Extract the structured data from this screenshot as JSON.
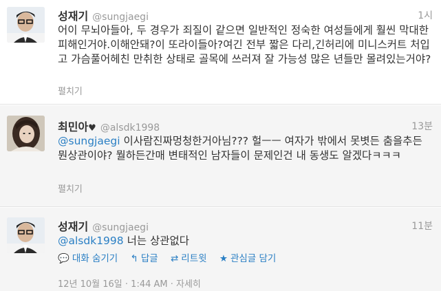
{
  "tweets": [
    {
      "fullname": "성재기",
      "screenname": "@sungjaegi",
      "time": "1시",
      "text": "어이 무뇌아들아, 두 경우가 죄질이 같으면 일반적인 정숙한 여성들에게 훨씬 막대한 피해인거야.이해안돼?이 또라이들아?여긴 전부 짧은 다리,긴허리에 미니스커트 처입고 가슴풀어헤친 만취한 상태로 골목에 쓰러져 잘 가능성 많은 년들만 몰려있는거야?",
      "expand": "펼치기"
    },
    {
      "fullname": "최민아",
      "heart": "♥",
      "screenname": "@alsdk1998",
      "time": "13분",
      "mention": "@sungjaegi",
      "text": " 이사람진짜멍청한거아님??? 헐ㅡㅡ 여자가 밖에서 못볏든 춤을추든 뭔상관이야? 뭘하든간매 변태적인 남자들이 문제인건 내 동생도 알겠다ㅋㅋㅋ",
      "expand": "펼치기"
    },
    {
      "fullname": "성재기",
      "screenname": "@sungjaegi",
      "time": "11분",
      "mention": "@alsdk1998",
      "text": " 너는 상관없다",
      "actions": [
        {
          "icon": "speech-bubble-icon",
          "glyph": "💬",
          "label": "대화 숨기기"
        },
        {
          "icon": "reply-icon",
          "glyph": "↰",
          "label": "답글"
        },
        {
          "icon": "retweet-icon",
          "glyph": "⇄",
          "label": "리트윗"
        },
        {
          "icon": "star-icon",
          "glyph": "★",
          "label": "관심글 담기"
        }
      ],
      "meta": "12년 10월 16일 · 1:44 AM · 자세히"
    }
  ]
}
